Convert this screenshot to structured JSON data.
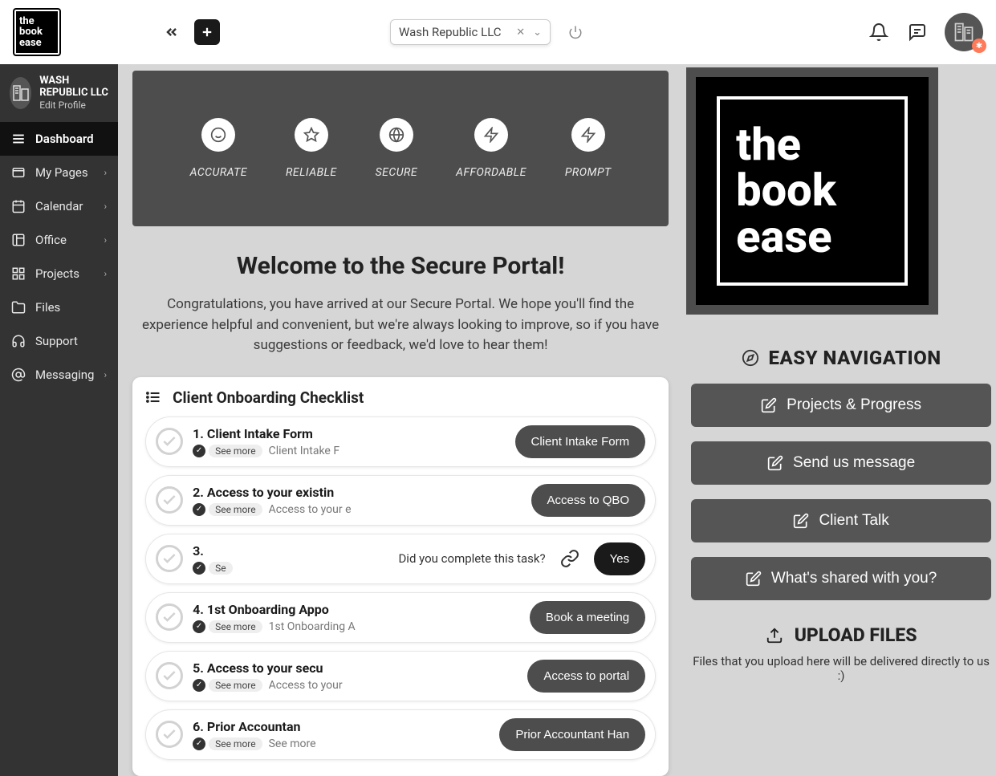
{
  "logo": {
    "l1": "the",
    "l2": "book",
    "l3": "ease"
  },
  "topbar": {
    "company": "Wash Republic LLC"
  },
  "profile": {
    "name": "WASH REPUBLIC LLC",
    "edit": "Edit Profile"
  },
  "nav": [
    {
      "label": "Dashboard",
      "has_chev": false,
      "active": true,
      "icon": "menu"
    },
    {
      "label": "My Pages",
      "has_chev": true,
      "active": false,
      "icon": "pages"
    },
    {
      "label": "Calendar",
      "has_chev": true,
      "active": false,
      "icon": "calendar"
    },
    {
      "label": "Office",
      "has_chev": true,
      "active": false,
      "icon": "office"
    },
    {
      "label": "Projects",
      "has_chev": true,
      "active": false,
      "icon": "projects"
    },
    {
      "label": "Files",
      "has_chev": false,
      "active": false,
      "icon": "folder"
    },
    {
      "label": "Support",
      "has_chev": false,
      "active": false,
      "icon": "support"
    },
    {
      "label": "Messaging",
      "has_chev": true,
      "active": false,
      "icon": "at"
    }
  ],
  "banner": [
    {
      "label": "ACCURATE",
      "icon": "smile"
    },
    {
      "label": "RELIABLE",
      "icon": "star"
    },
    {
      "label": "SECURE",
      "icon": "globe"
    },
    {
      "label": "AFFORDABLE",
      "icon": "bolt"
    },
    {
      "label": "PROMPT",
      "icon": "bolt"
    }
  ],
  "welcome": {
    "heading": "Welcome to the Secure Portal!",
    "body": "Congratulations, you have arrived at our Secure Portal. We hope you'll find the experience helpful and convenient, but we're always looking to improve, so if you have suggestions or feedback, we'd love to hear them!"
  },
  "checklist": {
    "title": "Client Onboarding Checklist",
    "see_more": "See more",
    "items": [
      {
        "title": "1. Client Intake Form",
        "sub": "Client Intake F",
        "action": "Client Intake Form",
        "type": "normal"
      },
      {
        "title": "2. Access to your existin",
        "sub": "Access to your e",
        "action": "Access to QBO",
        "type": "normal"
      },
      {
        "title": "3.",
        "sub": "Se",
        "prompt": "Did you complete this task?",
        "action": "Yes",
        "type": "prompt"
      },
      {
        "title": "4. 1st Onboarding Appo",
        "sub": "1st Onboarding A",
        "action": "Book a meeting",
        "type": "normal"
      },
      {
        "title": "5. Access to your secu",
        "sub": "Access to your",
        "action": "Access to portal",
        "type": "normal"
      },
      {
        "title": "6. Prior Accountan",
        "sub": "See more",
        "action": "Prior Accountant Han",
        "type": "normal"
      }
    ]
  },
  "right": {
    "nav_heading": "EASY NAVIGATION",
    "buttons": [
      "Projects & Progress",
      "Send us message",
      "Client Talk",
      "What's shared with you?"
    ],
    "upload_heading": "UPLOAD FILES",
    "upload_sub": "Files that you upload here will be delivered directly to us :)"
  }
}
